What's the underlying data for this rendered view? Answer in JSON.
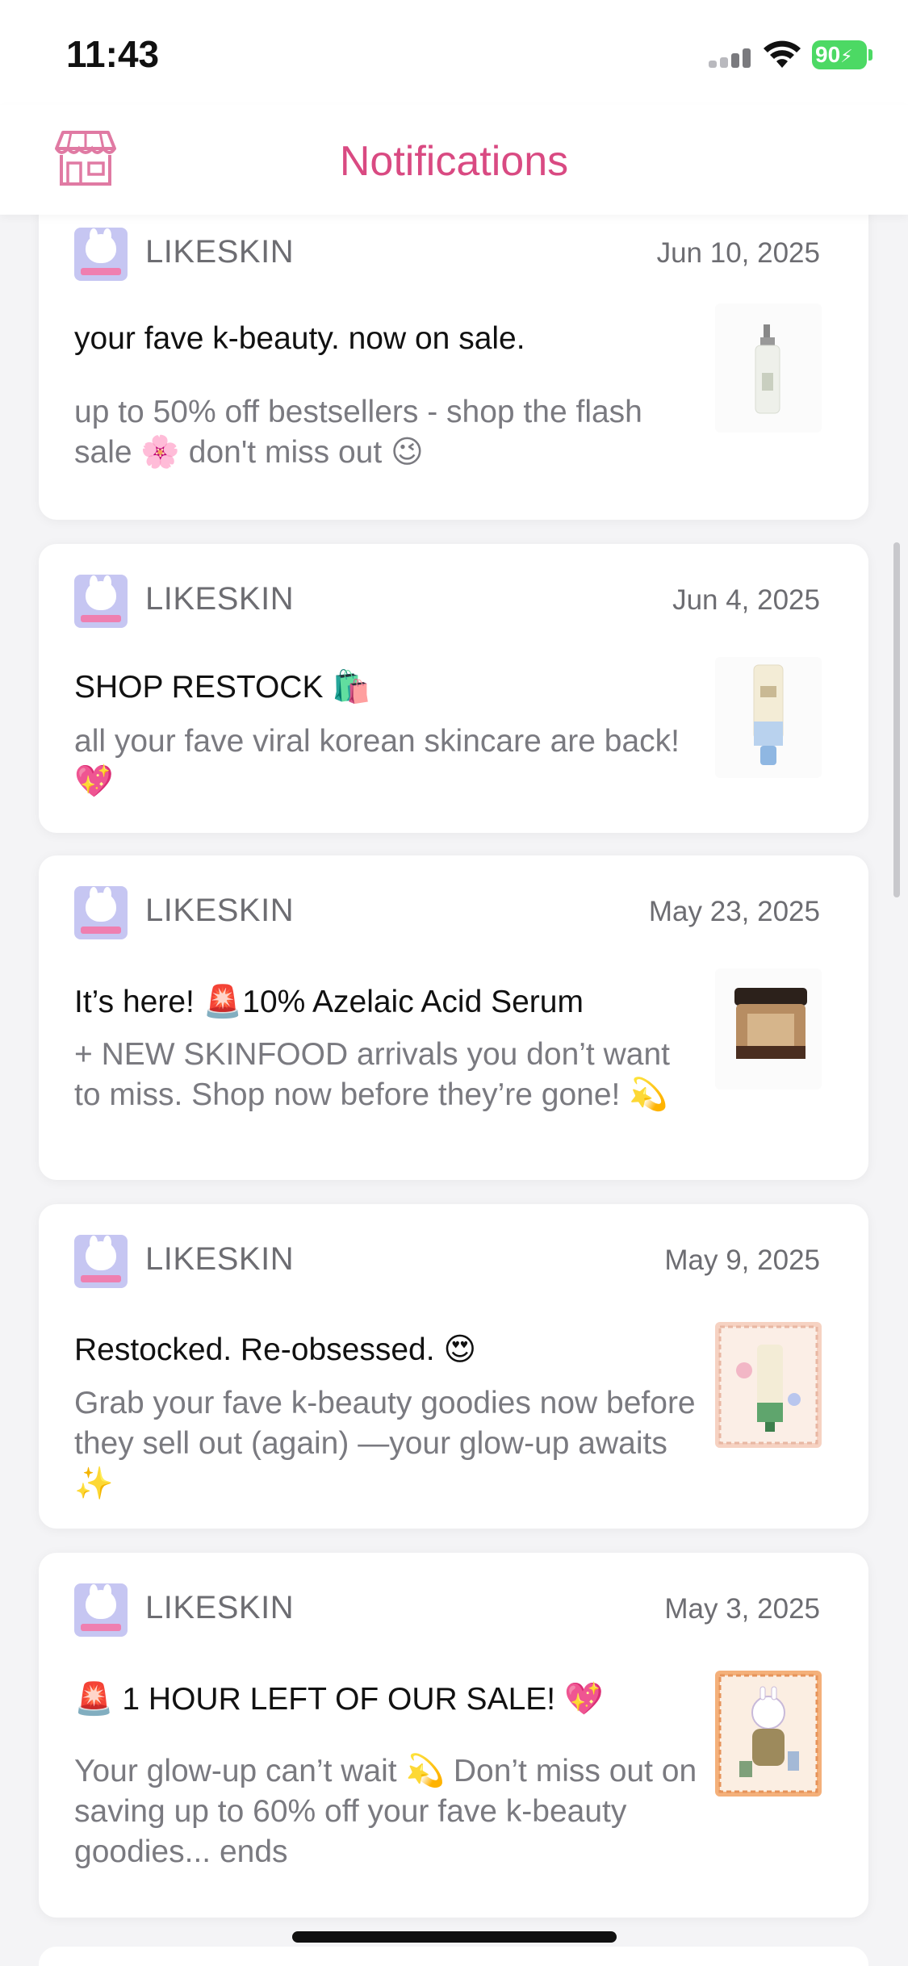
{
  "status_bar": {
    "time": "11:43",
    "battery": "90",
    "battery_color": "#4cd964"
  },
  "nav": {
    "title": "Notifications",
    "title_color": "#d94a82",
    "left_icon": "store-icon"
  },
  "notifications": [
    {
      "sender": "LIKESKIN",
      "date": "Jun 10, 2025",
      "title": "your fave k-beauty. now on sale.",
      "body": "up to 50% off bestsellers - shop the flash sale 🌸 don't miss out 😉",
      "thumbnail": "cleansing-oil-bottle"
    },
    {
      "sender": "LIKESKIN",
      "date": "Jun 4, 2025",
      "title": "SHOP RESTOCK 🛍️",
      "body": "all your fave viral korean skincare are back! 💖",
      "thumbnail": "sunscreen-tube"
    },
    {
      "sender": "LIKESKIN",
      "date": "May 23, 2025",
      "title": "It’s here! 🚨10% Azelaic Acid Serum",
      "body": "+ NEW SKINFOOD arrivals you don’t want to miss. Shop now before they’re gone! 💫",
      "thumbnail": "cream-jar"
    },
    {
      "sender": "LIKESKIN",
      "date": "May 9, 2025",
      "title": "Restocked. Re-obsessed. 😍",
      "body": "Grab your fave k-beauty goodies now before they sell out (again) —your glow-up awaits ✨",
      "thumbnail": "purito-stamp-illustration"
    },
    {
      "sender": "LIKESKIN",
      "date": "May 3, 2025",
      "title": "🚨 1 HOUR LEFT OF OUR SALE! 💖",
      "body": "Your glow-up can’t wait 💫 Don’t miss out on saving up to 60% off your fave k-beauty goodies... ends",
      "thumbnail": "bunny-stamp-illustration"
    }
  ]
}
